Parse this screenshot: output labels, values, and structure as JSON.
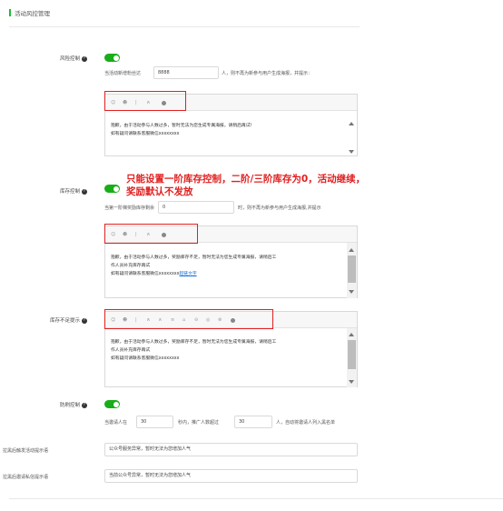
{
  "section": {
    "title": "活动风控管理"
  },
  "risk": {
    "label": "风险控制",
    "hint_pre": "当活动新增粉丝达",
    "value": "8888",
    "hint_post": "人，则不再为新参与用户生成海报，并提示：",
    "editor_line1": "抱歉，由于活动参与人数过多，暂时无法为您生成专属海报，请稍后再试！",
    "editor_line2": "如有疑问请联系客服微信xxxxxxxx"
  },
  "stock": {
    "label": "库存控制",
    "hint_pre": "当第一阶梯奖励库存剩余",
    "value": "0",
    "hint_post": "时，则不再为新参与用户生成海报,并提示",
    "editor_line1": "抱歉，由于活动参与人数过多，奖励库存不足，暂时无法为您生成专属海报，请稍后工",
    "editor_line2": "作人员补充库存再试",
    "editor_line3_pre": "如有疑问请联系客服微信xxxxxxxx",
    "editor_link": "超链文字"
  },
  "annotation": {
    "line1": "只能设置一阶库存控制，二阶/三阶库存为0，活动继续，",
    "line2": "奖励默认不发放"
  },
  "stockshort": {
    "label": "库存不足提示",
    "editor_line1": "抱歉，由于活动参与人数过多，奖励库存不足，暂时无法为您生成专属海报，请稍后工",
    "editor_line2": "作人员补充库存再试",
    "editor_line3": "如有疑问请联系客服微信xxxxxxxx"
  },
  "anti": {
    "label": "防刷控制",
    "hint_pre": "当邀请人在",
    "seconds": "30",
    "hint_mid": "秒内，推广人数超过",
    "count": "30",
    "hint_post": "人，自动将邀请人列入黑名单"
  },
  "blacklist_tip": {
    "label": "拉黑后触发活动提示语",
    "value": "公众号服务异常，暂时无法为您增加人气"
  },
  "blacklist_private": {
    "label": "拉黑后邀请私信提示语",
    "value": "当前公众号异常，暂时无法为您增加人气"
  },
  "colors": {
    "accent": "#1aad19",
    "annotation": "#e02020",
    "link": "#1a6fd6"
  },
  "icons": [
    "question-icon",
    "emoji-icon",
    "image-icon",
    "link-icon",
    "bold-icon"
  ]
}
